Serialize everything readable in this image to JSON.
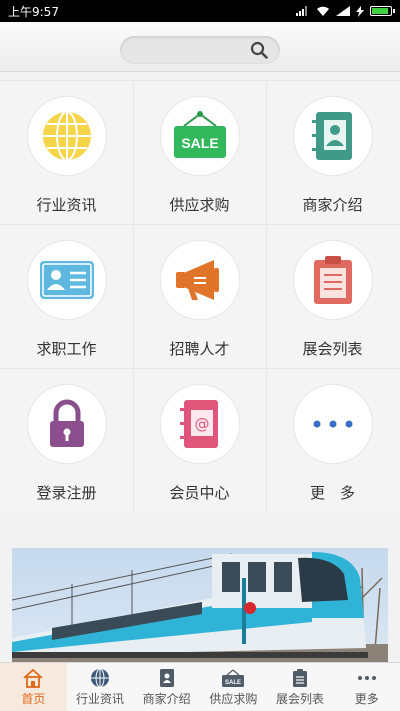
{
  "status_bar": {
    "time": "上午9:57"
  },
  "search": {
    "placeholder": ""
  },
  "grid": [
    {
      "label": "行业资讯",
      "icon": "globe-icon"
    },
    {
      "label": "供应求购",
      "icon": "sale-sign-icon",
      "sign_text": "SALE"
    },
    {
      "label": "商家介绍",
      "icon": "contact-book-icon"
    },
    {
      "label": "求职工作",
      "icon": "id-card-icon"
    },
    {
      "label": "招聘人才",
      "icon": "megaphone-icon"
    },
    {
      "label": "展会列表",
      "icon": "clipboard-icon"
    },
    {
      "label": "登录注册",
      "icon": "padlock-icon"
    },
    {
      "label": "会员中心",
      "icon": "address-book-icon",
      "symbol": "@"
    },
    {
      "label": "更　多",
      "icon": "more-dots-icon"
    }
  ],
  "tabs": [
    {
      "label": "首页",
      "icon": "home-icon",
      "active": true
    },
    {
      "label": "行业资讯",
      "icon": "globe-icon",
      "active": false
    },
    {
      "label": "商家介绍",
      "icon": "contact-book-icon",
      "active": false
    },
    {
      "label": "供应求购",
      "icon": "sale-sign-icon",
      "active": false,
      "sign_text": "SALE"
    },
    {
      "label": "展会列表",
      "icon": "clipboard-icon",
      "active": false
    },
    {
      "label": "更多",
      "icon": "more-dots-icon",
      "active": false
    }
  ],
  "colors": {
    "accent": "#e06a1b",
    "banner_train": "#2fb3d6"
  }
}
